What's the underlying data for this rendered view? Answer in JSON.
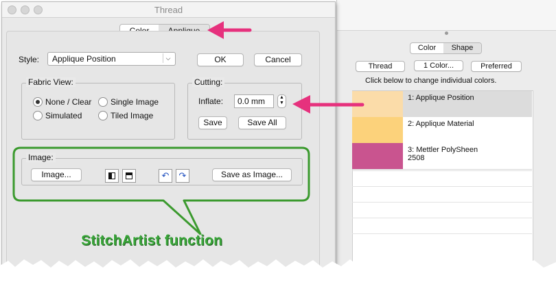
{
  "thread_dialog": {
    "title": "Thread",
    "tabs": [
      "Color",
      "Applique"
    ],
    "style_label": "Style:",
    "style_value": "Applique Position",
    "ok_label": "OK",
    "cancel_label": "Cancel",
    "fabric_view": {
      "legend": "Fabric View:",
      "options": [
        "None / Clear",
        "Single Image",
        "Simulated",
        "Tiled Image"
      ],
      "selected": "None / Clear"
    },
    "cutting": {
      "legend": "Cutting:",
      "inflate_label": "Inflate:",
      "inflate_value": "0.0 mm",
      "save_label": "Save",
      "save_all_label": "Save All"
    },
    "image": {
      "legend": "Image:",
      "image_button": "Image...",
      "save_as_image_button": "Save as Image..."
    }
  },
  "shape_panel": {
    "tabs": [
      "Color",
      "Shape"
    ],
    "buttons": [
      "Thread",
      "1 Color...",
      "Preferred"
    ],
    "hint": "Click below to change individual colors.",
    "colors": [
      {
        "label": "1: Applique Position",
        "color": "#fbdca9"
      },
      {
        "label": "2: Applique Material",
        "color": "#fcd27b"
      },
      {
        "label": "3: Mettler PolySheen",
        "sub": "2508",
        "color": "#c9548f"
      }
    ]
  },
  "annotation": {
    "text": "StitchArtist function",
    "highlight_color": "#3b9a2e",
    "arrow_color": "#e6317d"
  }
}
